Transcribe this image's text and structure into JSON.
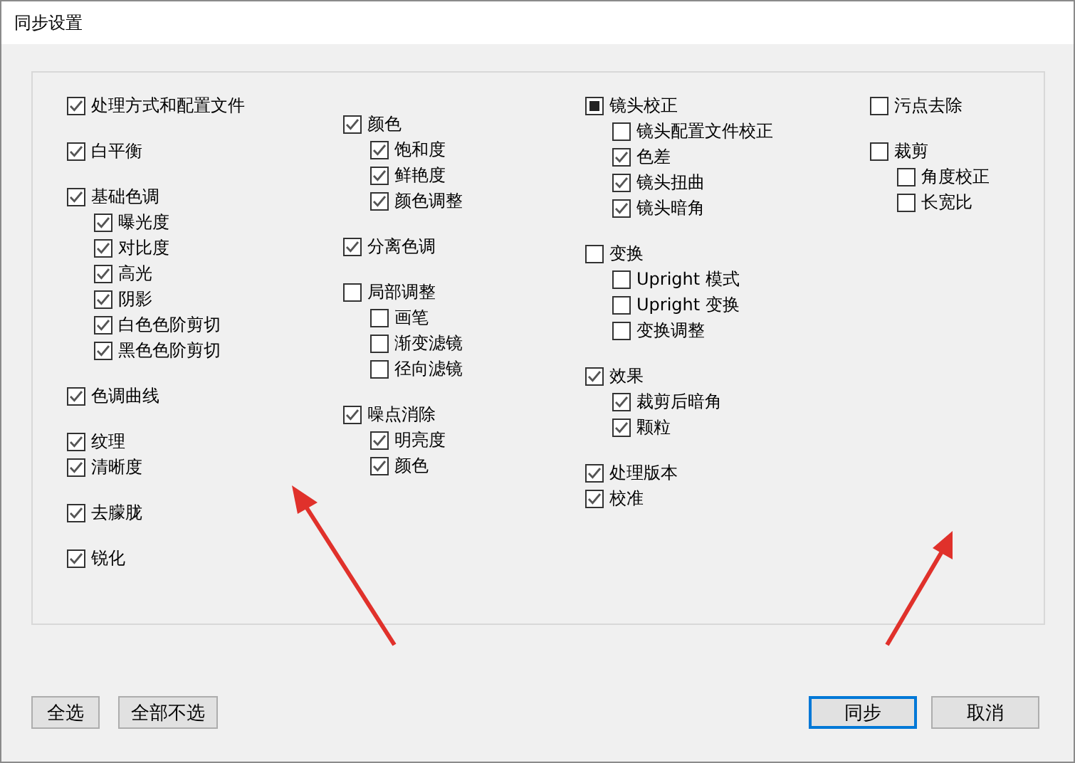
{
  "window": {
    "title": "同步设置"
  },
  "columns": [
    {
      "sections": [
        {
          "items": [
            {
              "label": "处理方式和配置文件",
              "checked": true,
              "indeterminate": false
            }
          ]
        },
        {
          "items": [
            {
              "label": "白平衡",
              "checked": true,
              "indeterminate": false
            }
          ]
        },
        {
          "items": [
            {
              "label": "基础色调",
              "checked": true,
              "indeterminate": false,
              "children": [
                {
                  "label": "曝光度",
                  "checked": true
                },
                {
                  "label": "对比度",
                  "checked": true
                },
                {
                  "label": "高光",
                  "checked": true
                },
                {
                  "label": "阴影",
                  "checked": true
                },
                {
                  "label": "白色色阶剪切",
                  "checked": true
                },
                {
                  "label": "黑色色阶剪切",
                  "checked": true
                }
              ]
            }
          ]
        },
        {
          "items": [
            {
              "label": "色调曲线",
              "checked": true,
              "indeterminate": false
            }
          ]
        },
        {
          "items": [
            {
              "label": "纹理",
              "checked": true,
              "indeterminate": false
            },
            {
              "label": "清晰度",
              "checked": true,
              "indeterminate": false
            }
          ]
        },
        {
          "items": [
            {
              "label": "去朦胧",
              "checked": true,
              "indeterminate": false
            }
          ]
        },
        {
          "items": [
            {
              "label": "锐化",
              "checked": true,
              "indeterminate": false
            }
          ]
        }
      ]
    },
    {
      "sections": [
        {
          "items": [
            {
              "label": "颜色",
              "checked": true,
              "indeterminate": false,
              "children": [
                {
                  "label": "饱和度",
                  "checked": true
                },
                {
                  "label": "鲜艳度",
                  "checked": true
                },
                {
                  "label": "颜色调整",
                  "checked": true
                }
              ]
            }
          ]
        },
        {
          "items": [
            {
              "label": "分离色调",
              "checked": true,
              "indeterminate": false
            }
          ]
        },
        {
          "items": [
            {
              "label": "局部调整",
              "checked": false,
              "indeterminate": false,
              "children": [
                {
                  "label": "画笔",
                  "checked": false
                },
                {
                  "label": "渐变滤镜",
                  "checked": false
                },
                {
                  "label": "径向滤镜",
                  "checked": false
                }
              ]
            }
          ]
        },
        {
          "items": [
            {
              "label": "噪点消除",
              "checked": true,
              "indeterminate": false,
              "children": [
                {
                  "label": "明亮度",
                  "checked": true
                },
                {
                  "label": "颜色",
                  "checked": true
                }
              ]
            }
          ]
        }
      ]
    },
    {
      "sections": [
        {
          "items": [
            {
              "label": "镜头校正",
              "checked": false,
              "indeterminate": true,
              "children": [
                {
                  "label": "镜头配置文件校正",
                  "checked": false
                },
                {
                  "label": "色差",
                  "checked": true
                },
                {
                  "label": "镜头扭曲",
                  "checked": true
                },
                {
                  "label": "镜头暗角",
                  "checked": true
                }
              ]
            }
          ]
        },
        {
          "items": [
            {
              "label": "变换",
              "checked": false,
              "indeterminate": false,
              "children": [
                {
                  "label": "Upright 模式",
                  "checked": false
                },
                {
                  "label": "Upright 变换",
                  "checked": false
                },
                {
                  "label": "变换调整",
                  "checked": false
                }
              ]
            }
          ]
        },
        {
          "items": [
            {
              "label": "效果",
              "checked": true,
              "indeterminate": false,
              "children": [
                {
                  "label": "裁剪后暗角",
                  "checked": true
                },
                {
                  "label": "颗粒",
                  "checked": true
                }
              ]
            }
          ]
        },
        {
          "items": [
            {
              "label": "处理版本",
              "checked": true,
              "indeterminate": false
            },
            {
              "label": "校准",
              "checked": true,
              "indeterminate": false
            }
          ]
        }
      ]
    },
    {
      "sections": [
        {
          "items": [
            {
              "label": "污点去除",
              "checked": false,
              "indeterminate": false
            }
          ]
        },
        {
          "items": [
            {
              "label": "裁剪",
              "checked": false,
              "indeterminate": false,
              "children": [
                {
                  "label": "角度校正",
                  "checked": false
                },
                {
                  "label": "长宽比",
                  "checked": false
                }
              ]
            }
          ]
        }
      ]
    }
  ],
  "left_buttons": [
    {
      "label": "全选"
    },
    {
      "label": "全部不选"
    }
  ],
  "right_buttons": [
    {
      "label": "同步",
      "focused": true
    },
    {
      "label": "取消",
      "focused": false
    }
  ]
}
